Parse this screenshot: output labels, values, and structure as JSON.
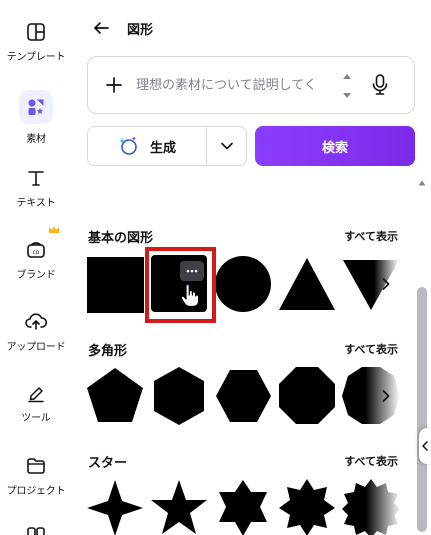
{
  "rail": {
    "items": [
      {
        "label": "テンプレート",
        "icon": "template-icon"
      },
      {
        "label": "素材",
        "icon": "elements-icon",
        "active": true
      },
      {
        "label": "テキスト",
        "icon": "text-icon"
      },
      {
        "label": "ブランド",
        "icon": "brand-icon"
      },
      {
        "label": "アップロード",
        "icon": "upload-icon"
      },
      {
        "label": "ツール",
        "icon": "draw-icon"
      },
      {
        "label": "プロジェクト",
        "icon": "folder-icon"
      }
    ]
  },
  "header": {
    "title": "図形",
    "back_icon": "arrow-left-icon"
  },
  "search": {
    "placeholder": "理想の素材について説明してく"
  },
  "actions": {
    "generate_label": "生成",
    "search_label": "検索"
  },
  "sections": [
    {
      "title": "基本の図形",
      "see_all": "すべて表示",
      "shapes": [
        "square",
        "rounded-square",
        "circle",
        "triangle",
        "inverted-triangle"
      ]
    },
    {
      "title": "多角形",
      "see_all": "すべて表示",
      "shapes": [
        "pentagon",
        "hexagon",
        "hexagon-flat",
        "octagon",
        "decagon"
      ]
    },
    {
      "title": "スター",
      "see_all": "すべて表示",
      "shapes": [
        "star-4",
        "star-5",
        "star-6",
        "star-8",
        "star-12"
      ]
    }
  ],
  "colors": {
    "accent": "#8b3dff",
    "highlight": "#d31a1a",
    "shape": "#000000"
  }
}
